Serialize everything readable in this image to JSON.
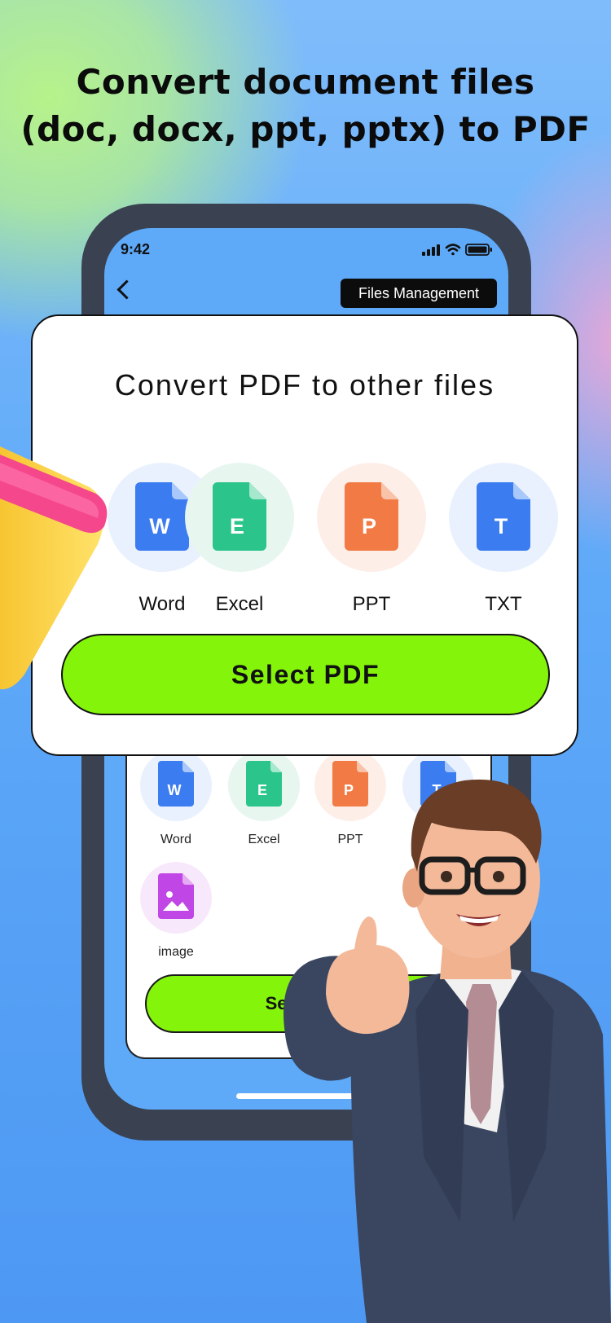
{
  "headline": {
    "line1": "Convert document files",
    "line2": "(doc, docx, ppt, pptx) to PDF"
  },
  "phone": {
    "status_time": "9:42",
    "back_icon": "chevron-left-icon",
    "files_management_label": "Files Management",
    "items": [
      {
        "label": "Word",
        "letter": "W",
        "color": "#3b7cf0",
        "bg": "#e8f1fd",
        "icon": "word-file-icon"
      },
      {
        "label": "Excel",
        "letter": "E",
        "color": "#2bc48a",
        "bg": "#e7f6ef",
        "icon": "excel-file-icon"
      },
      {
        "label": "PPT",
        "letter": "P",
        "color": "#f27a45",
        "bg": "#fdeee8",
        "icon": "ppt-file-icon"
      },
      {
        "label": "T",
        "letter": "T",
        "color": "#3b7cf0",
        "bg": "#e8f1fd",
        "icon": "txt-file-icon"
      },
      {
        "label": "image",
        "letter": "",
        "color": "#c046e6",
        "bg": "#f8e8fb",
        "icon": "image-file-icon"
      }
    ],
    "select_files_label": "Select File"
  },
  "card": {
    "title": "Convert PDF to other files",
    "options": [
      {
        "label": "Word",
        "letter": "W",
        "color": "#3b7cf0",
        "bg": "#e8f1fd",
        "icon": "word-file-icon"
      },
      {
        "label": "Excel",
        "letter": "E",
        "color": "#2bc48a",
        "bg": "#e7f6ef",
        "icon": "excel-file-icon"
      },
      {
        "label": "PPT",
        "letter": "P",
        "color": "#f27a45",
        "bg": "#fdeee8",
        "icon": "ppt-file-icon"
      },
      {
        "label": "TXT",
        "letter": "T",
        "color": "#3b7cf0",
        "bg": "#e8f1fd",
        "icon": "txt-file-icon"
      }
    ],
    "select_pdf_label": "Select PDF"
  },
  "colors": {
    "accent_green": "#84f50a",
    "background_blue": "#5ea9f8"
  }
}
